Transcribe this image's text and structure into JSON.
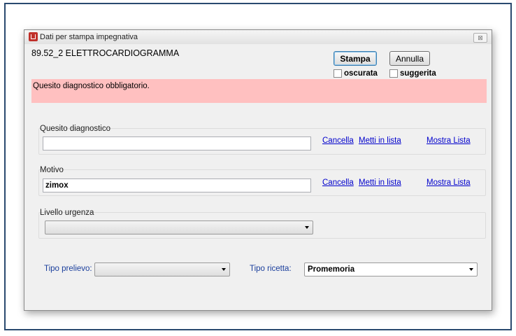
{
  "window": {
    "title": "Dati per stampa impegnativa",
    "close_symbol": "⊠"
  },
  "exam": {
    "title": "89.52_2 ELETTROCARDIOGRAMMA"
  },
  "actions": {
    "print_label": "Stampa",
    "cancel_label": "Annulla",
    "obscured_label": "oscurata",
    "suggested_label": "suggerita"
  },
  "error": {
    "message": "Quesito diagnostico obbligatorio."
  },
  "quesito": {
    "label": "Quesito diagnostico",
    "value": "",
    "link_cancel": "Cancella",
    "link_add": "Metti in lista",
    "link_show": "Mostra Lista"
  },
  "motivo": {
    "label": "Motivo",
    "value": "zimox",
    "link_cancel": "Cancella",
    "link_add": "Metti in lista",
    "link_show": "Mostra Lista"
  },
  "urgenza": {
    "label": "Livello urgenza",
    "value": ""
  },
  "prelievo": {
    "label": "Tipo prelievo:",
    "value": ""
  },
  "ricetta": {
    "label": "Tipo ricetta:",
    "value": "Promemoria"
  },
  "colors": {
    "error_background": "#ffc0c0",
    "link": "#0000cc",
    "label_blue": "#1a3e9c",
    "frame_border": "#2a4a6f"
  }
}
